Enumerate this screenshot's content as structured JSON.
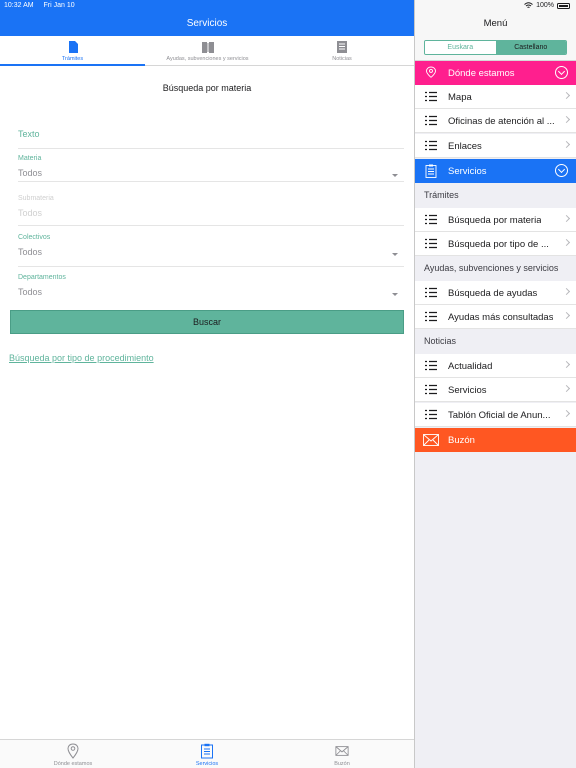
{
  "status": {
    "time": "10:32 AM",
    "date": "Fri Jan 10",
    "battery": "100%"
  },
  "left": {
    "nav_title": "Servicios",
    "tabs": [
      {
        "label": "Trámites",
        "icon": "document-icon"
      },
      {
        "label": "Ayudas, subvenciones y servicios",
        "icon": "book-icon"
      },
      {
        "label": "Noticias",
        "icon": "newspaper-icon"
      }
    ],
    "heading": "Búsqueda por materia",
    "form": {
      "texto_placeholder": "Texto",
      "materia_label": "Materia",
      "materia_value": "Todos",
      "submateria_label": "Submateria",
      "submateria_value": "Todos",
      "colectivos_label": "Colectivos",
      "colectivos_value": "Todos",
      "departamentos_label": "Departamentos",
      "departamentos_value": "Todos",
      "search_button": "Buscar"
    },
    "link": "Búsqueda por tipo de procedimiento",
    "bottom_tabs": [
      {
        "label": "Dónde estamos",
        "icon": "location-pin-icon"
      },
      {
        "label": "Servicios",
        "icon": "clipboard-icon"
      },
      {
        "label": "Buzón",
        "icon": "envelope-icon"
      }
    ]
  },
  "menu": {
    "title": "Menú",
    "languages": [
      "Euskara",
      "Castellano"
    ],
    "selected_language": "Castellano",
    "donde": "Dónde estamos",
    "items_top": [
      "Mapa",
      "Oficinas de atención al ...",
      "Enlaces"
    ],
    "servicios": "Servicios",
    "sections": {
      "tramites": "Trámites",
      "tramites_items": [
        "Búsqueda por materia",
        "Búsqueda por tipo de ..."
      ],
      "ayudas": "Ayudas, subvenciones y servicios",
      "ayudas_items": [
        "Búsqueda de ayudas",
        "Ayudas más consultadas"
      ],
      "noticias": "Noticias",
      "noticias_items": [
        "Actualidad",
        "Servicios",
        "Tablón Oficial de Anun..."
      ]
    },
    "buzon": "Buzón"
  },
  "colors": {
    "primary_blue": "#1a73f5",
    "accent_green": "#5fb49c",
    "pink": "#ff1f8e",
    "orange": "#ff5722"
  }
}
